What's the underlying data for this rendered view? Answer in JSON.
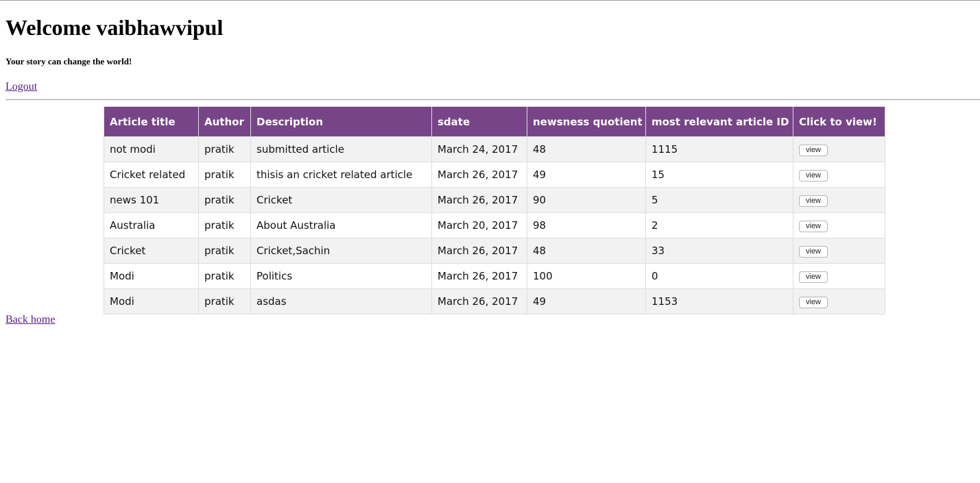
{
  "header": {
    "welcome": "Welcome vaibhawvipul",
    "tagline": "Your story can change the world!",
    "logout_label": "Logout"
  },
  "table": {
    "columns": [
      "Article title",
      "Author",
      "Description",
      "sdate",
      "newsness quotient",
      "most relevant article ID",
      "Click to view!"
    ],
    "rows": [
      {
        "title": "not modi",
        "author": "pratik",
        "description": "submitted article",
        "sdate": "March 24, 2017",
        "newsness": "48",
        "relevant_id": "1115",
        "view_label": "view"
      },
      {
        "title": "Cricket related",
        "author": "pratik",
        "description": "thisis an cricket related article",
        "sdate": "March 26, 2017",
        "newsness": "49",
        "relevant_id": "15",
        "view_label": "view"
      },
      {
        "title": "news 101",
        "author": "pratik",
        "description": "Cricket",
        "sdate": "March 26, 2017",
        "newsness": "90",
        "relevant_id": "5",
        "view_label": "view"
      },
      {
        "title": "Australia",
        "author": "pratik",
        "description": "About Australia",
        "sdate": "March 20, 2017",
        "newsness": "98",
        "relevant_id": "2",
        "view_label": "view"
      },
      {
        "title": "Cricket",
        "author": "pratik",
        "description": "Cricket,Sachin",
        "sdate": "March 26, 2017",
        "newsness": "48",
        "relevant_id": "33",
        "view_label": "view"
      },
      {
        "title": "Modi",
        "author": "pratik",
        "description": "Politics",
        "sdate": "March 26, 2017",
        "newsness": "100",
        "relevant_id": "0",
        "view_label": "view"
      },
      {
        "title": "Modi",
        "author": "pratik",
        "description": "asdas",
        "sdate": "March 26, 2017",
        "newsness": "49",
        "relevant_id": "1153",
        "view_label": "view"
      }
    ]
  },
  "footer": {
    "back_home_label": "Back home"
  },
  "colors": {
    "header_bg": "#774488",
    "link": "#551a8b"
  }
}
